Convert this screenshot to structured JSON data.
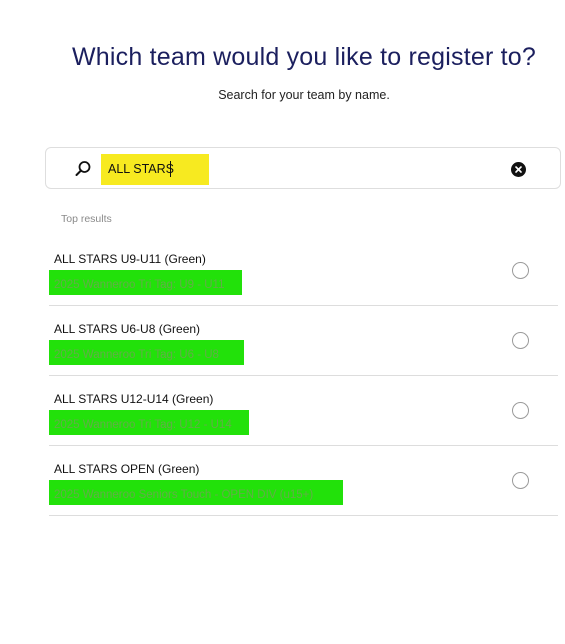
{
  "header": {
    "title": "Which team would you like to register to?",
    "subtitle": "Search for your team by name."
  },
  "search": {
    "value": "ALL STARS",
    "icon": "search-icon",
    "clear_icon": "close-circle-icon",
    "highlight_color": "#f7ea20"
  },
  "results": {
    "label": "Top results",
    "highlight_color": "#22e10a",
    "items": [
      {
        "team": "ALL STARS U9-U11 (Green)",
        "competition": "2025 Wanneroo Tri Tag: U9 - U11",
        "selected": false
      },
      {
        "team": "ALL STARS U6-U8 (Green)",
        "competition": "2025 Wanneroo Tri Tag: U6 - U8",
        "selected": false
      },
      {
        "team": "ALL STARS U12-U14 (Green)",
        "competition": "2025 Wanneroo Tri Tag: U12 - U14",
        "selected": false
      },
      {
        "team": "ALL STARS OPEN (Green)",
        "competition": "2025 Wanneroo Seniors Touch - OPEN DIV (u15+)",
        "selected": false
      }
    ]
  },
  "colors": {
    "title": "#1b1f5e",
    "text": "#111111",
    "muted": "#8a8a8a"
  }
}
